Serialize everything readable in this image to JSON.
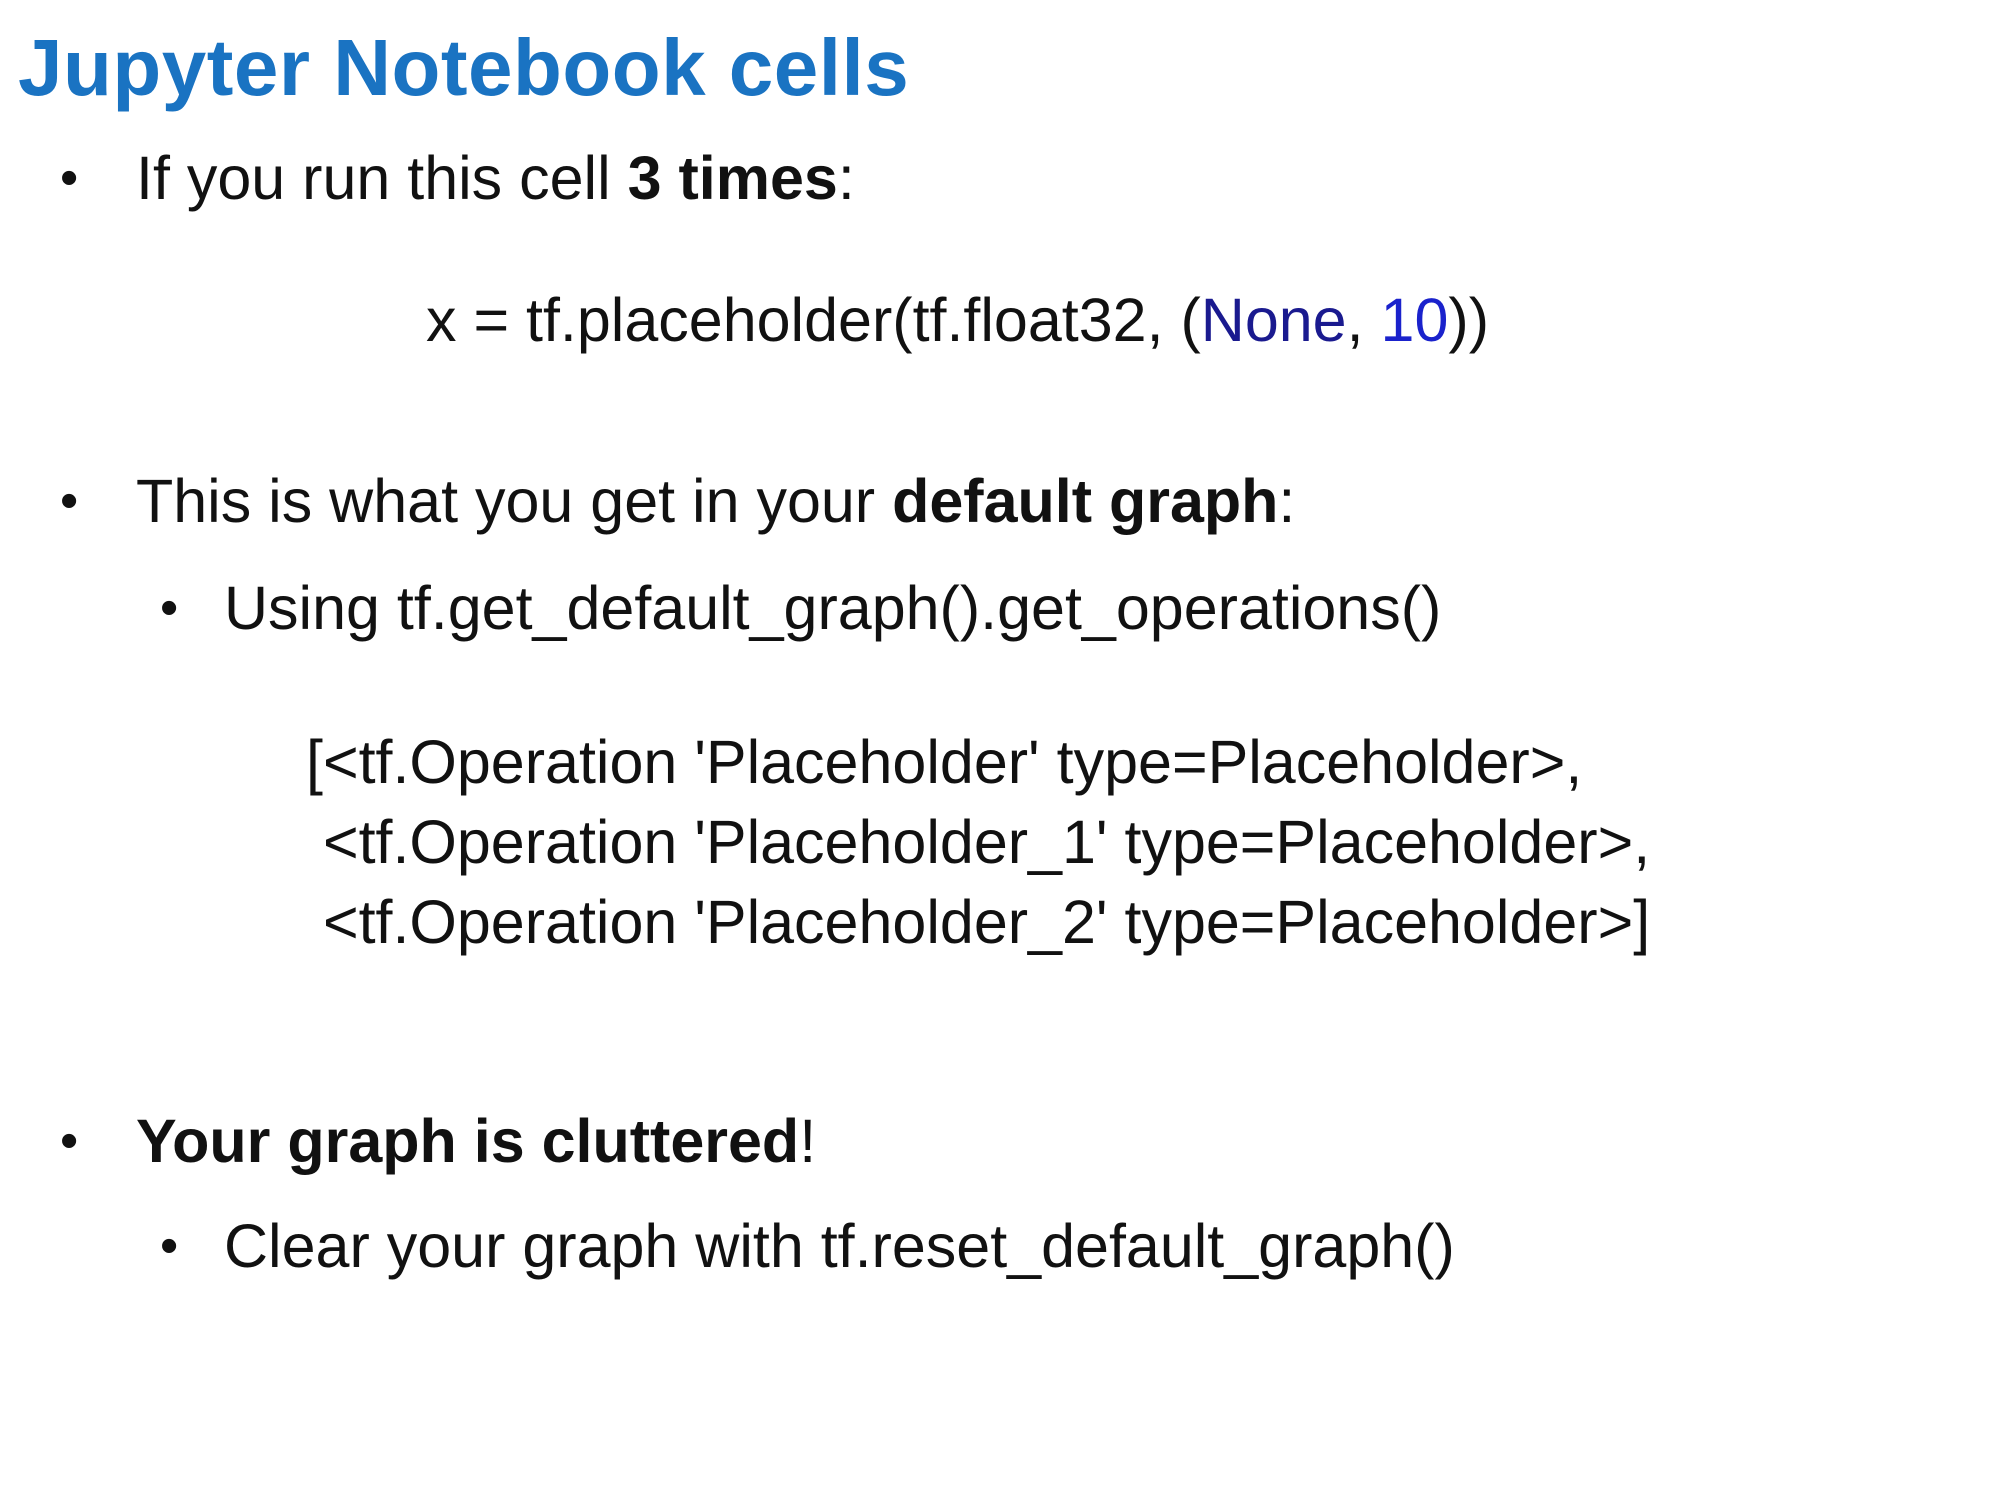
{
  "slide": {
    "title": "Jupyter Notebook cells",
    "bullets": {
      "b1": {
        "text": "If you run this cell ",
        "bold": "3 times",
        "suffix": ":"
      },
      "code": {
        "prefix": "x = tf.placeholder(tf.float32, (",
        "none": "None",
        "sep": ", ",
        "num": "10",
        "suffix": "))"
      },
      "b2": {
        "text": "This is what you get in your ",
        "bold": "default graph",
        "suffix": ":"
      },
      "b2_sub": "Using tf.get_default_graph().get_operations()",
      "ops": [
        "[<tf.Operation 'Placeholder' type=Placeholder>,",
        " <tf.Operation 'Placeholder_1' type=Placeholder>,",
        " <tf.Operation 'Placeholder_2' type=Placeholder>]"
      ],
      "b3": {
        "bold": "Your graph is cluttered",
        "suffix": "!"
      },
      "b3_sub": "Clear your graph with tf.reset_default_graph()"
    },
    "bullet_char": "•",
    "colors": {
      "title": "#1a73c2",
      "none_keyword": "#1a1a8f",
      "number_literal": "#1a22cc"
    }
  }
}
